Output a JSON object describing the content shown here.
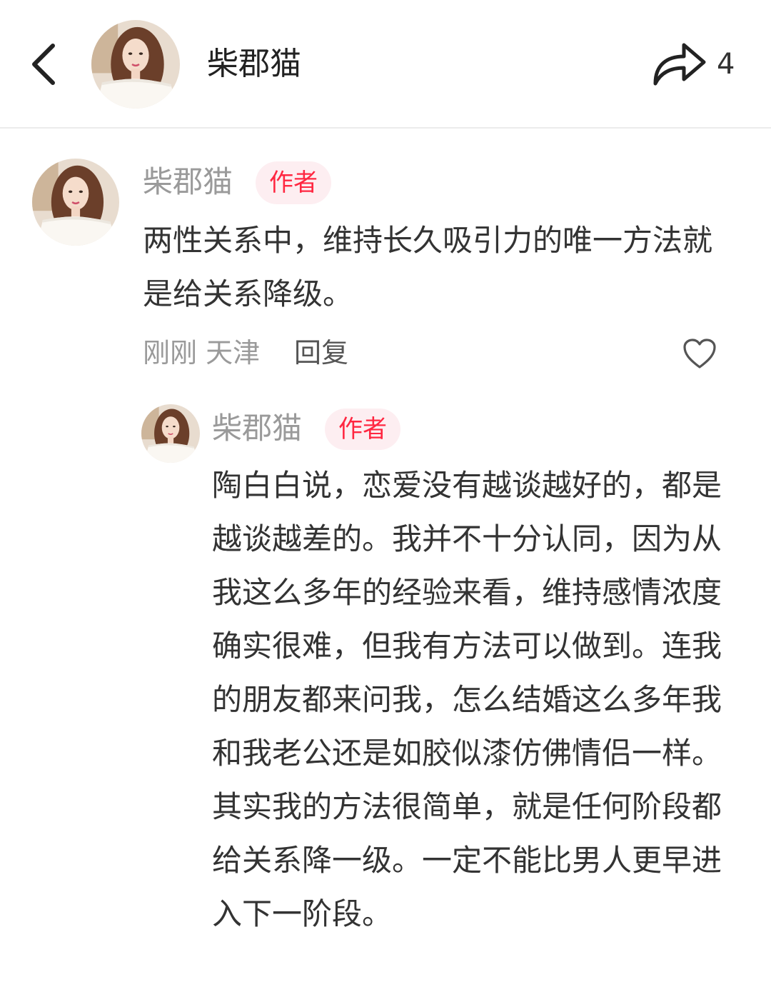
{
  "header": {
    "title": "柴郡猫",
    "share_count": "4",
    "back_icon": "chevron-left-icon",
    "share_icon": "share-arrow-icon"
  },
  "comments": [
    {
      "author": "柴郡猫",
      "badge": "作者",
      "text": "两性关系中，维持长久吸引力的唯一方法就是给关系降级。",
      "time": "刚刚",
      "location": "天津",
      "reply_label": "回复",
      "like_icon": "heart-outline-icon"
    },
    {
      "author": "柴郡猫",
      "badge": "作者",
      "text": "陶白白说，恋爱没有越谈越好的，都是越谈越差的。我并不十分认同，因为从我这么多年的经验来看，维持感情浓度确实很难，但我有方法可以做到。连我的朋友都来问我，怎么结婚这么多年我和我老公还是如胶似漆仿佛情侣一样。其实我的方法很简单，就是任何阶段都给关系降一级。一定不能比男人更早进入下一阶段。"
    }
  ],
  "colors": {
    "badge_text": "#ff2741",
    "badge_bg": "#fdeef1",
    "secondary_text": "#9a9a9a",
    "primary_text": "#333333"
  }
}
